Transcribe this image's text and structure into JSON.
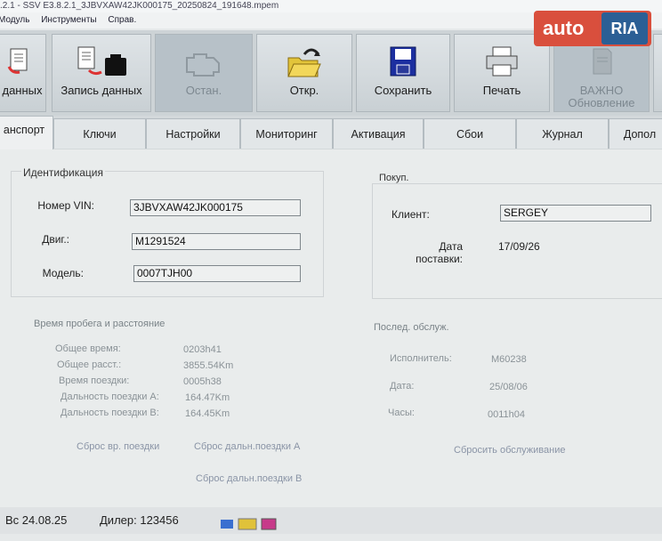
{
  "window": {
    "title": ".2.1 - SSV E3.8.2.1_3JBVXAW42JK000175_20250824_191648.mpem"
  },
  "menu": {
    "items": [
      "Модуль",
      "Инструменты",
      "Справ."
    ]
  },
  "toolbar": {
    "buttons": [
      {
        "label": "данных"
      },
      {
        "label": "Запись данных"
      },
      {
        "label": "Остан."
      },
      {
        "label": "Откр."
      },
      {
        "label": "Сохранить"
      },
      {
        "label": "Печать"
      },
      {
        "label": "ВАЖНО",
        "sublabel": "Обновление"
      }
    ]
  },
  "tabs": [
    "анспорт",
    "Ключи",
    "Настройки",
    "Мониторинг",
    "Активация",
    "Сбои",
    "Журнал",
    "Допол"
  ],
  "identification": {
    "legend": "Идентификация",
    "vin_label": "Номер VIN:",
    "vin_value": "3JBVXAW42JK000175",
    "engine_label": "Двиг.:",
    "engine_value": "M1291524",
    "model_label": "Модель:",
    "model_value": "0007TJH00"
  },
  "buyer": {
    "legend": "Покуп.",
    "client_label": "Клиент:",
    "client_value": "SERGEY",
    "delivery_label": "Дата поставки:",
    "delivery_value": "17/09/26"
  },
  "mileage": {
    "legend": "Время пробега и расстояние",
    "rows": [
      {
        "label": "Общее время:",
        "value": "0203h41"
      },
      {
        "label": "Общее расст.:",
        "value": "3855.54Km"
      },
      {
        "label": "Время поездки:",
        "value": "0005h38"
      },
      {
        "label": "Дальность поездки A:",
        "value": "164.47Km"
      },
      {
        "label": "Дальность поездки B:",
        "value": "164.45Km"
      }
    ],
    "reset_time": "Сброс вр. поездки",
    "reset_a": "Сброс дальн.поездки A",
    "reset_b": "Сброс дальн.поездки B"
  },
  "service": {
    "legend": "Послед. обслуж.",
    "executor_label": "Исполнитель:",
    "executor_value": "M60238",
    "date_label": "Дата:",
    "date_value": "25/08/06",
    "hours_label": "Часы:",
    "hours_value": "0011h04",
    "reset": "Сбросить обслуживание"
  },
  "status": {
    "version": "Вс 24.08.25",
    "dealer": "Дилер: 123456"
  },
  "watermark": {
    "text": "auto",
    "brand": "RIA"
  }
}
